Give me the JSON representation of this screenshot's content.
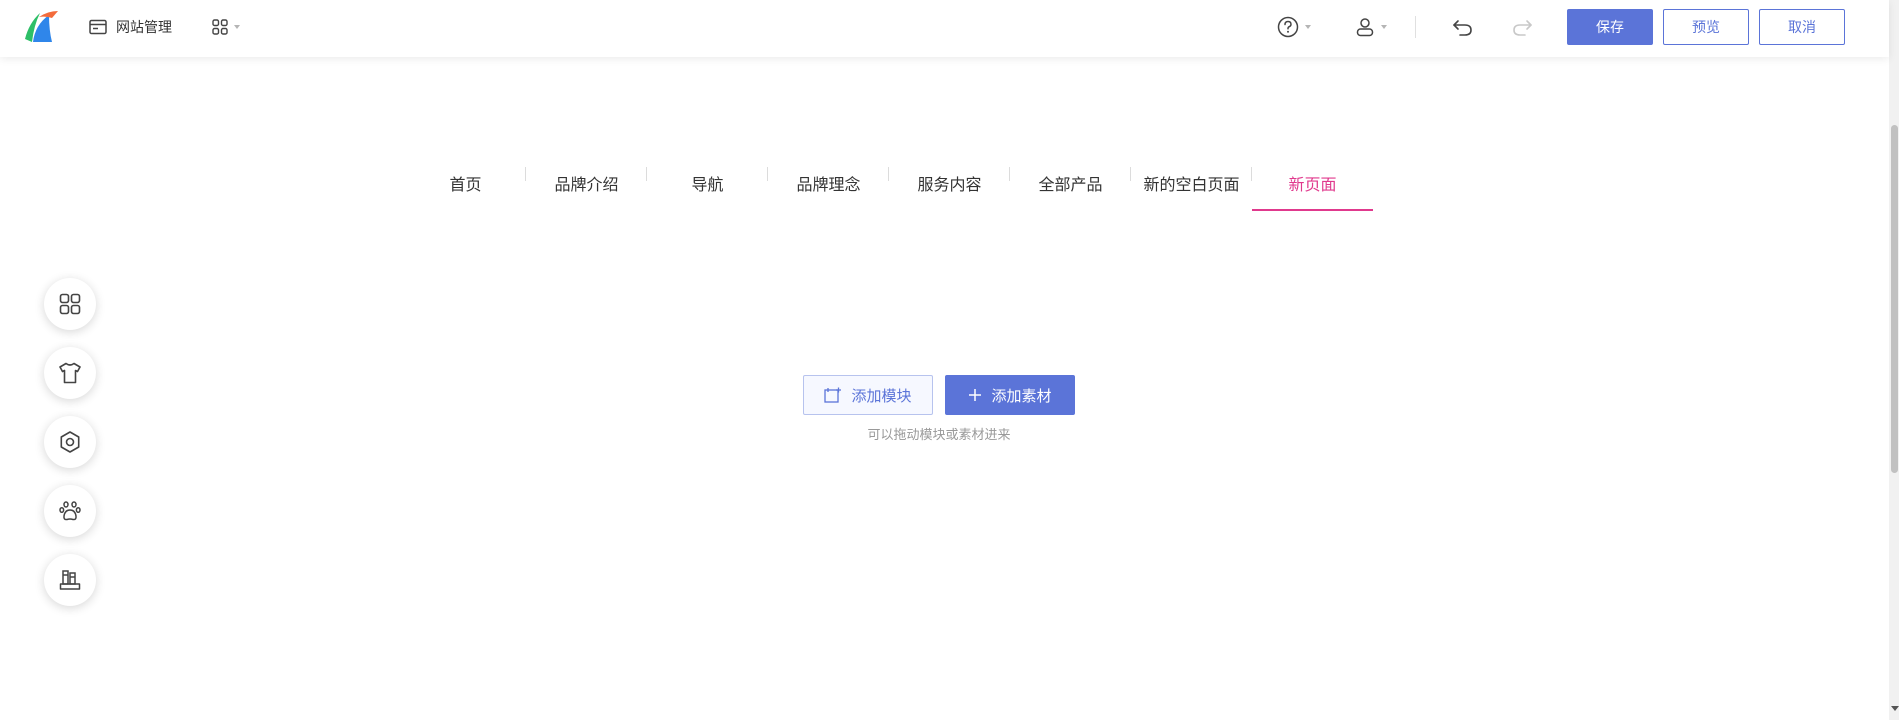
{
  "toolbar": {
    "site_management_label": "网站管理",
    "save_label": "保存",
    "preview_label": "预览",
    "cancel_label": "取消",
    "icons": [
      "logo-icon",
      "site-management-icon",
      "apps-grid-icon",
      "help-icon",
      "user-icon",
      "undo-icon",
      "redo-icon"
    ]
  },
  "page_nav": {
    "items": [
      {
        "label": "首页",
        "active": false
      },
      {
        "label": "品牌介绍",
        "active": false
      },
      {
        "label": "导航",
        "active": false
      },
      {
        "label": "品牌理念",
        "active": false
      },
      {
        "label": "服务内容",
        "active": false
      },
      {
        "label": "全部产品",
        "active": false
      },
      {
        "label": "新的空白页面",
        "active": false
      },
      {
        "label": "新页面",
        "active": true
      }
    ]
  },
  "left_tools": [
    "modules-icon",
    "theme-shirt-icon",
    "settings-gear-icon",
    "paw-icon",
    "library-books-icon"
  ],
  "empty_state": {
    "add_module_label": "添加模块",
    "add_material_label": "添加素材",
    "hint": "可以拖动模块或素材进来"
  },
  "colors": {
    "primary": "#5b74d8",
    "active_tab": "#e0398d",
    "text": "#333333",
    "hint_text": "#999999"
  }
}
